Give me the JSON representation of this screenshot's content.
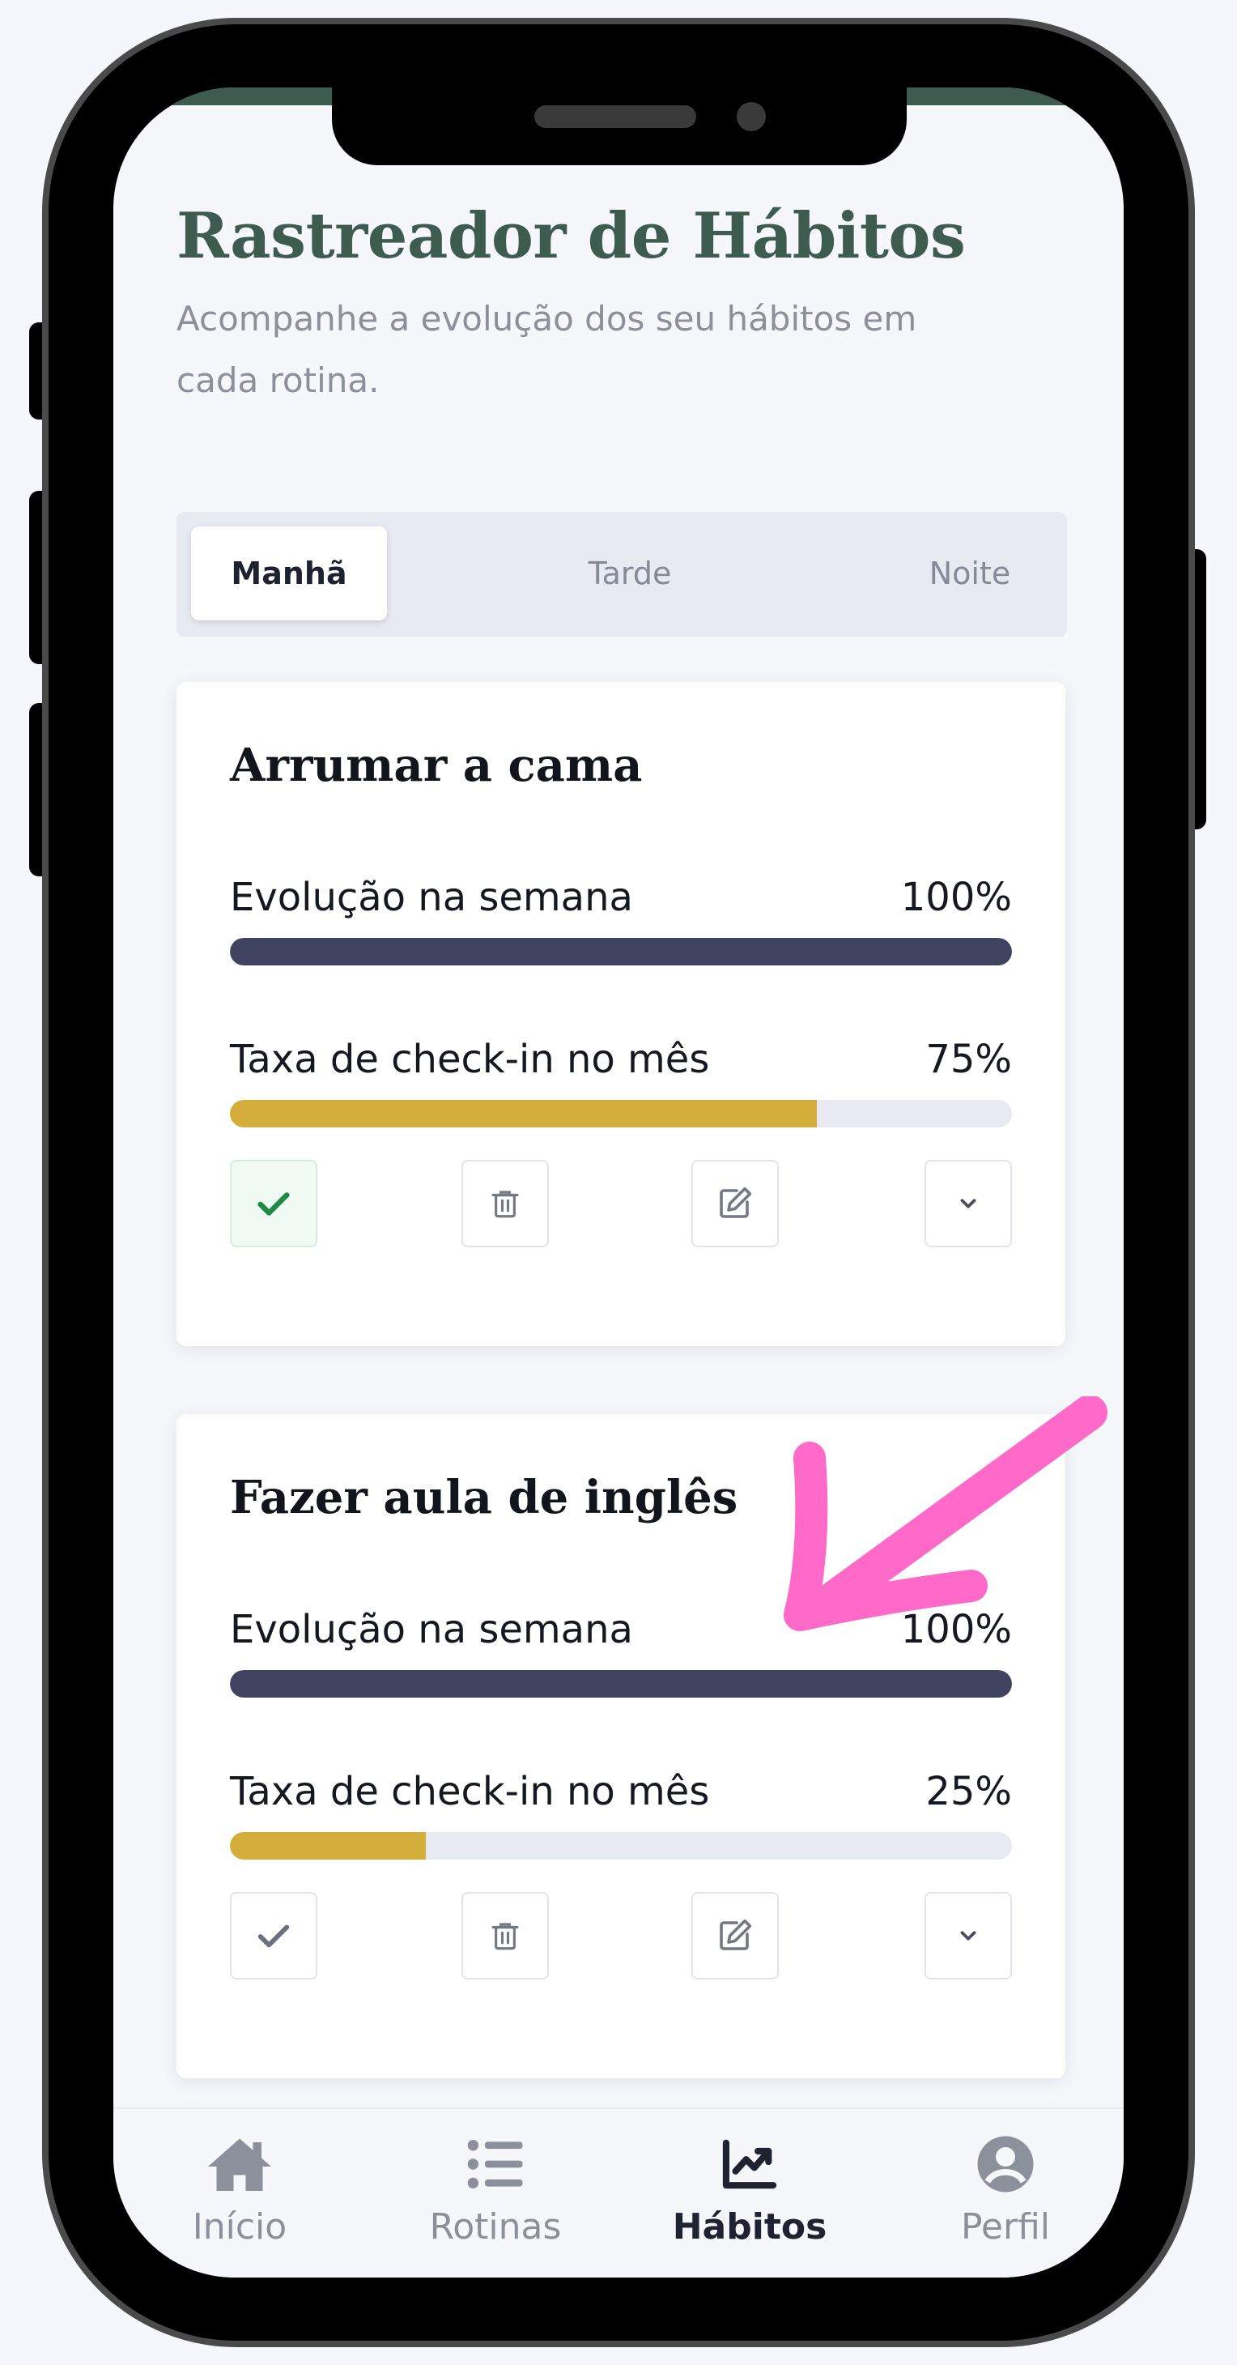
{
  "header": {
    "title": "Rastreador de Hábitos",
    "subtitle": "Acompanhe a evolução dos seu hábitos em cada rotina."
  },
  "tabs": [
    {
      "label": "Manhã",
      "active": true
    },
    {
      "label": "Tarde",
      "active": false
    },
    {
      "label": "Noite",
      "active": false
    }
  ],
  "habits": [
    {
      "name": "Arrumar a cama",
      "week_label": "Evolução na semana",
      "week_value": "100%",
      "week_progress": 1.0,
      "month_label": "Taxa de check-in no mês",
      "month_value": "75%",
      "month_progress": 0.75,
      "checked": true
    },
    {
      "name": "Fazer aula de inglês",
      "week_label": "Evolução na semana",
      "week_value": "100%",
      "week_progress": 1.0,
      "month_label": "Taxa de check-in no mês",
      "month_value": "25%",
      "month_progress": 0.25,
      "checked": false
    }
  ],
  "icons": {
    "check": "check-icon",
    "delete": "trash-icon",
    "edit": "edit-icon",
    "expand": "chevron-down-icon",
    "annotation": "pink-arrow-icon"
  },
  "nav": [
    {
      "label": "Início",
      "icon": "home-icon",
      "active": false
    },
    {
      "label": "Rotinas",
      "icon": "list-icon",
      "active": false
    },
    {
      "label": "Hábitos",
      "icon": "chart-line-icon",
      "active": true
    },
    {
      "label": "Perfil",
      "icon": "user-circle-icon",
      "active": false
    }
  ],
  "colors": {
    "brand": "#3d5c4f",
    "week_bar": "#3f435f",
    "month_bar": "#d4ae3a",
    "check_done": "#1e8a45",
    "annotation": "#ff69c8"
  }
}
